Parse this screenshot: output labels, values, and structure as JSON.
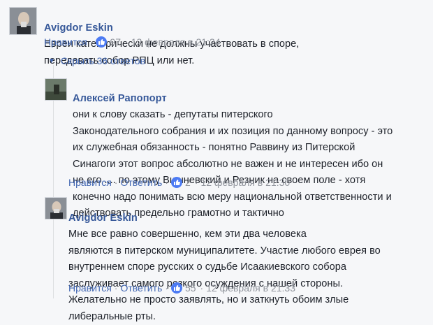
{
  "comments": [
    {
      "author": "Avigdor Eskin",
      "text": "Евреи категорически не должны участвовать в споре,\nпередавать собор РПЦ или нет.",
      "like_label": "Нравится",
      "reply_label": "",
      "likes": "97",
      "timestamp": "12 февраля в 21:24"
    },
    {
      "author": "Алексей Рапопорт",
      "text": "они к слову сказать - депутаты питерского\nЗаконодательного собрания и их позиция по данному вопросу - это\nих служебная обязанность - понятно Раввину из Питерской\nСинагоги этот вопрос абсолютно не важен и не интересен ибо он\nне его .... по этому Вишневский и Резник на своем поле - хотя\nконечно надо понимать всю меру национальной ответственности и\nдействовать предельно грамотно и тактично",
      "like_label": "Нравится",
      "reply_label": "Ответить",
      "likes": "2",
      "timestamp": "12 февраля в 21:30"
    },
    {
      "author": "Avigdor Eskin",
      "text": "Мне все равно совершенно, кем эти два человека\nявляются в питерском муниципалитете. Участие любого еврея во\nвнутреннем споре русских о судьбе Исаакиевского собора\nзаслуживает самого резкого осуждения с нашей стороны.\nЖелательно не просто заявлять, но и заткнуть обоим злые\nлиберальные рты.",
      "like_label": "Нравится",
      "reply_label": "Ответить",
      "likes": "55",
      "timestamp": "12 февраля в 21:33"
    }
  ],
  "hide_replies_label": "Скрыть 36 ответов",
  "colors": {
    "link": "#4267b2",
    "author": "#365899",
    "meta": "#90949c",
    "like": "#4d7bf3",
    "background": "#f6f7f9"
  },
  "icons": [
    "like-icon",
    "triangle-down-icon",
    "avatar"
  ]
}
